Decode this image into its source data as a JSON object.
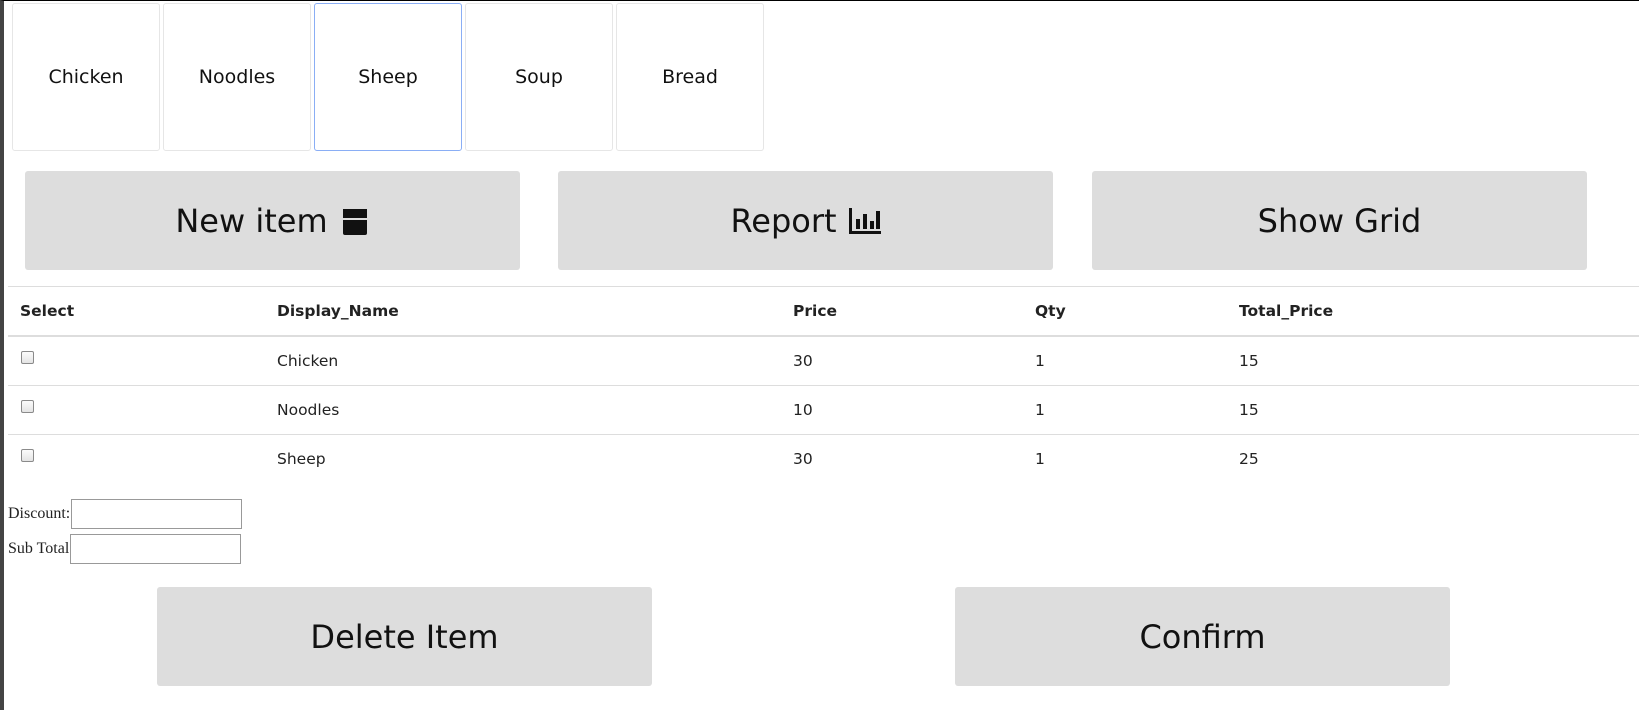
{
  "categories": [
    "Chicken",
    "Noodles",
    "Sheep",
    "Soup",
    "Bread"
  ],
  "active_category": "Sheep",
  "buttons": {
    "new_item": "New item",
    "report": "Report",
    "show_grid": "Show Grid",
    "delete_item": "Delete Item",
    "confirm": "Confirm"
  },
  "icons": {
    "new_item": "box-icon",
    "report": "bar-chart-icon"
  },
  "table": {
    "headers": [
      "Select",
      "Display_Name",
      "Price",
      "Qty",
      "Total_Price"
    ],
    "rows": [
      {
        "name": "Chicken",
        "price": "30",
        "qty": "1",
        "total": "15"
      },
      {
        "name": "Noodles",
        "price": "10",
        "qty": "1",
        "total": "15"
      },
      {
        "name": "Sheep",
        "price": "30",
        "qty": "1",
        "total": "25"
      }
    ]
  },
  "form": {
    "discount_label": "Discount:",
    "discount_value": "",
    "subtotal_label": "Sub Total",
    "subtotal_value": ""
  },
  "colors": {
    "button_bg": "#dddddd",
    "active_tab_border": "#8aaef5"
  }
}
